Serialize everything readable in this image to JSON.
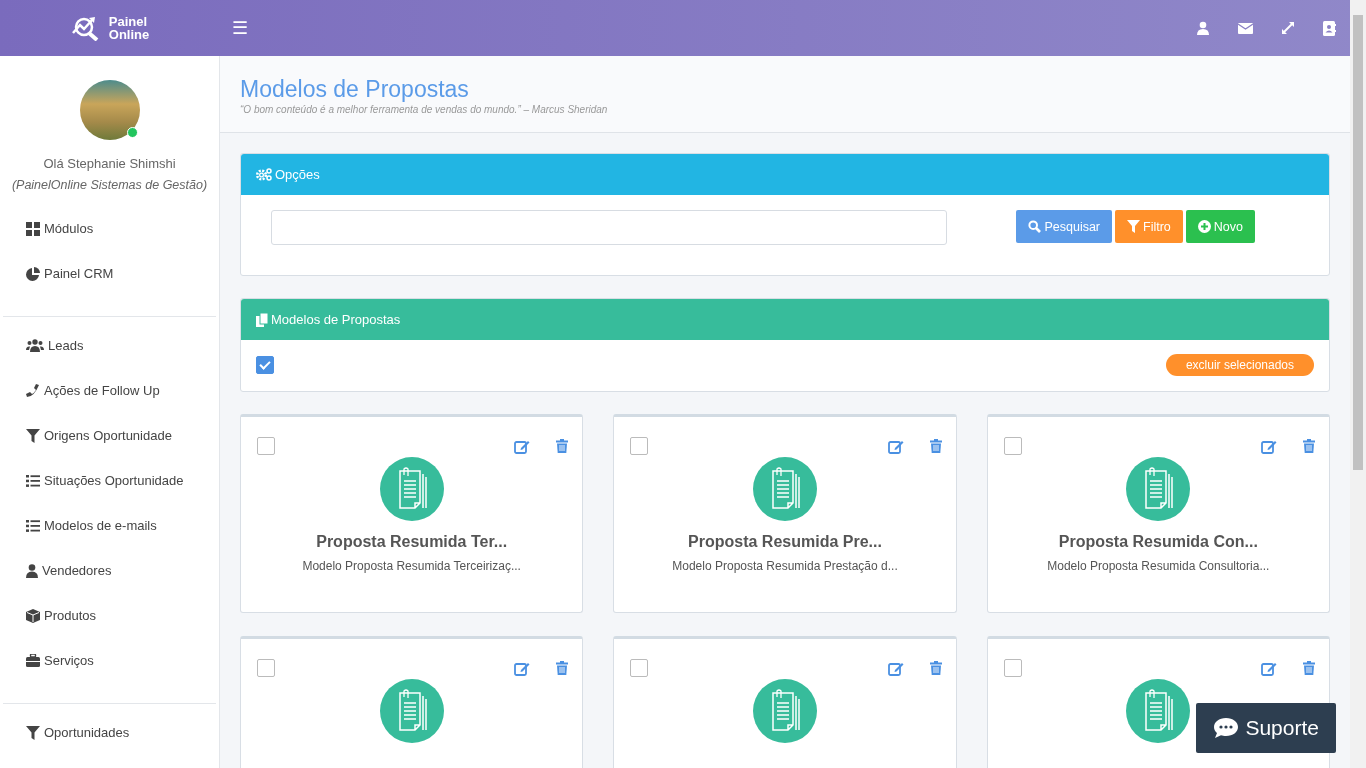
{
  "brand": {
    "line1": "Painel",
    "line2": "Online"
  },
  "topbar": {
    "menu_icon": "☰"
  },
  "user": {
    "greeting": "Olá Stephanie Shimshi",
    "company": "(PainelOnline Sistemas de Gestão)",
    "online": true
  },
  "sidebar": {
    "groups": [
      {
        "items": [
          {
            "label": "Módulos",
            "kind": "grid"
          },
          {
            "label": "Painel CRM",
            "kind": "pie"
          }
        ]
      },
      {
        "items": [
          {
            "label": "Leads",
            "kind": "users"
          },
          {
            "label": "Ações de Follow Up",
            "kind": "phone"
          },
          {
            "label": "Origens Oportunidade",
            "kind": "filter"
          },
          {
            "label": "Situações Oportunidade",
            "kind": "list"
          },
          {
            "label": "Modelos de e-mails",
            "kind": "list"
          },
          {
            "label": "Vendedores",
            "kind": "user"
          },
          {
            "label": "Produtos",
            "kind": "box"
          },
          {
            "label": "Serviços",
            "kind": "briefcase"
          }
        ]
      },
      {
        "items": [
          {
            "label": "Oportunidades",
            "kind": "filter"
          }
        ]
      }
    ]
  },
  "page": {
    "title": "Modelos de Propostas",
    "subtitle": "“O bom conteúdo é a melhor ferramenta de vendas do mundo.” – Marcus Sheridan"
  },
  "options_panel": {
    "title": "Opções",
    "buttons": [
      {
        "label": "Pesquisar",
        "kind": "search"
      },
      {
        "label": "Filtro",
        "kind": "filter"
      },
      {
        "label": "Novo",
        "kind": "new"
      }
    ]
  },
  "models_panel": {
    "title": "Modelos de Propostas",
    "select_all": {
      "checked": true
    },
    "delete_button": "excluir selecionados"
  },
  "cards": [
    {
      "title": "Proposta Resumida Ter...",
      "description": "Modelo Proposta Resumida Terceirizaç...",
      "checked": false
    },
    {
      "title": "Proposta Resumida Pre...",
      "description": "Modelo Proposta Resumida Prestação d...",
      "checked": false
    },
    {
      "title": "Proposta Resumida Con...",
      "description": "Modelo Proposta Resumida Consultoria...",
      "checked": false
    },
    {
      "checked": false
    },
    {
      "checked": false
    },
    {
      "checked": false
    }
  ],
  "support_button": "Suporte"
}
